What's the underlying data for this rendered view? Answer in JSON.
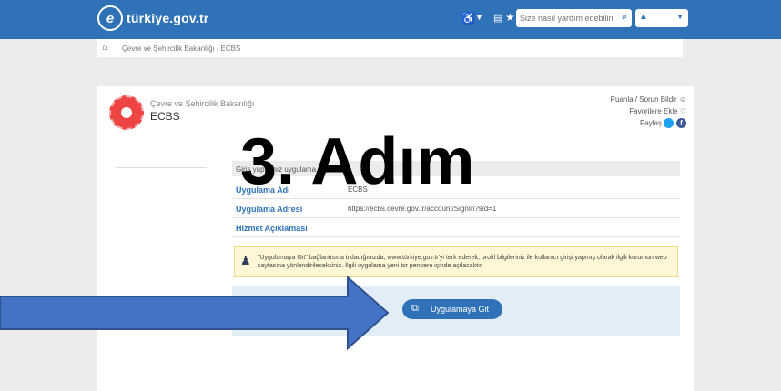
{
  "header": {
    "logo_text": "türkiye.gov.tr",
    "logo_mark": "e",
    "accessibility_icon": "♿",
    "accessibility_caret": "▼",
    "id_icon": "▤",
    "favorites_icon": "★",
    "search": {
      "placeholder": "Size nasıl yardım edebilirim?",
      "icon": "search-icon"
    },
    "user_icon": "▲",
    "user_caret": "▼"
  },
  "breadcrumb": {
    "items": [
      "Çevre ve Şehircilik Bakanlığı",
      "ECBS"
    ],
    "separator": "/"
  },
  "service_header": {
    "ministry": "Çevre ve Şehircilik Bakanlığı",
    "service_name": "ECBS",
    "links": {
      "rate": "Puanla / Sorun Bildir",
      "favorite": "Favorilere Ekle",
      "share": "Paylaş"
    }
  },
  "intro_text": "Giriş yap    ğınız uygulama ı                     e;",
  "info_rows": [
    {
      "label": "Uygulama Adı",
      "value": "ECBS"
    },
    {
      "label": "Uygulama Adresi",
      "value": "https://ecbs.cevre.gov.tr/account/SignIn?sid=1"
    },
    {
      "label": "Hizmet Açıklaması",
      "value": ""
    }
  ],
  "notice": "\"Uygulamaya Git\" bağlantısına tıkladığınızda, www.türkiye.gov.tr'yi terk ederek, profil bilgileriniz ile kullanıcı girişi yapmış olarak ilgili kurumun web sayfasına yönlendirileceksiniz. İlgili uygulama yeni bir pencere içinde açılacaktır.",
  "go_button": {
    "label": "Uygulamaya Git",
    "icon": "⧉"
  },
  "overlay": {
    "step_title": "3. Adım",
    "arrow_color": "#4472c4",
    "arrow_stroke": "#2f528f"
  },
  "colors": {
    "brand": "#2f72b8",
    "notice_bg": "#fff7d6",
    "panel_bg": "#e3edf7"
  }
}
